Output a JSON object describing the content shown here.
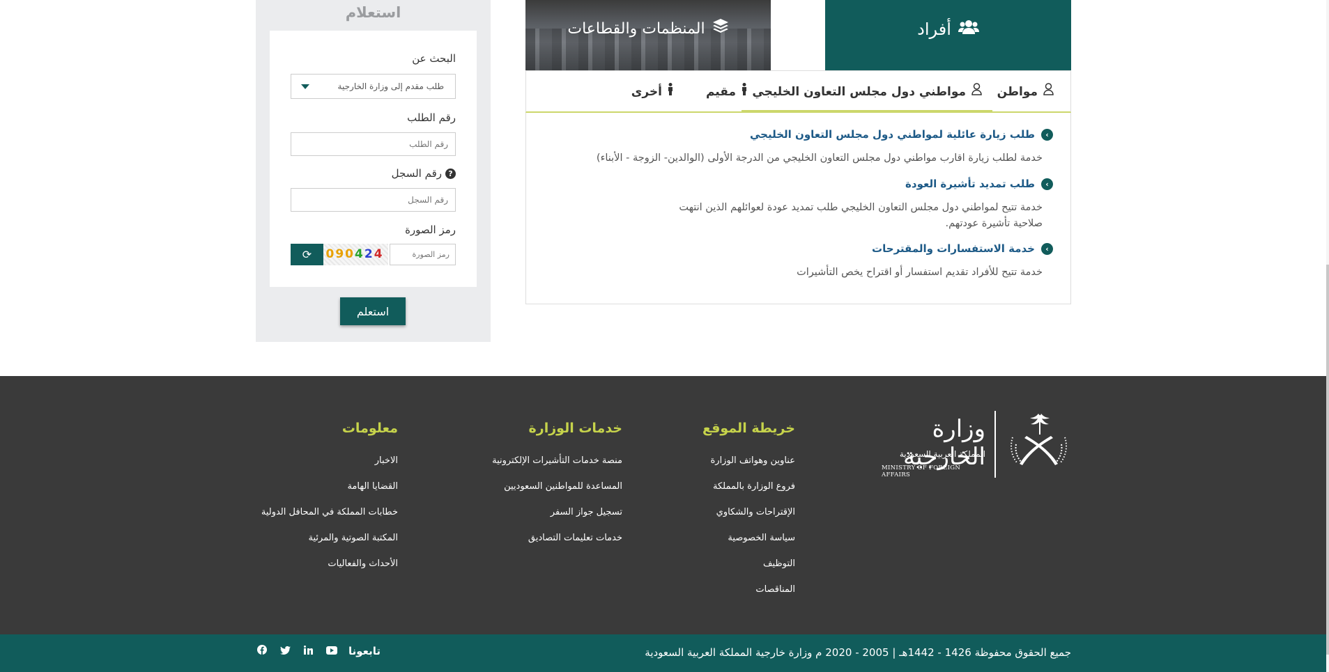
{
  "inquiry": {
    "title": "استعلام",
    "search_label": "البحث عن",
    "search_value": "طلب مقدم إلى وزارة الخارجية",
    "request_no_label": "رقم الطلب",
    "request_no_placeholder": "رقم الطلب",
    "record_no_label": "رقم السجل",
    "record_no_placeholder": "رقم السجل",
    "captcha_label": "رمز الصورة",
    "captcha_placeholder": "رمز الصورة",
    "captcha_text": [
      "0",
      "9",
      "0",
      "4",
      "2",
      "4"
    ],
    "submit_label": "استعلم"
  },
  "tabs": {
    "individuals": "أفراد",
    "organizations": "المنظمات والقطاعات"
  },
  "subtabs": {
    "citizen": "مواطن",
    "gcc": "مواطني دول مجلس التعاون الخليجي",
    "resident": "مقيم",
    "other": "أخرى"
  },
  "services": [
    {
      "title": "طلب زيارة عائلية لمواطني دول مجلس التعاون الخليجي",
      "desc": "خدمة لطلب زيارة اقارب مواطني دول مجلس التعاون الخليجي من الدرجة الأولى (الوالدين- الزوجة - الأبناء)"
    },
    {
      "title": "طلب تمديد تأشيرة العودة",
      "desc": "خدمة تتيح لمواطني دول مجلس التعاون الخليجي طلب تمديد عودة لعوائلهم الذين انتهت صلاحية تأشيرة عودتهم."
    },
    {
      "title": "خدمة الاستفسارات والمقترحات",
      "desc": "خدمة تتيح للأفراد تقديم استفسار أو اقتراح يخص التأشيرات"
    }
  ],
  "footer": {
    "logo": {
      "name_ar": "وزارة الخارجية",
      "country_ar": "المملكة العربية السعودية",
      "name_en": "MINISTRY OF FOREIGN AFFAIRS"
    },
    "sitemap": {
      "title": "خريطة الموقع",
      "links": [
        "عناوين وهواتف الوزارة",
        "فروع الوزارة بالمملكة",
        "الإقتراحات والشكاوي",
        "سياسة الخصوصية",
        "التوظيف",
        "المناقصات"
      ]
    },
    "services": {
      "title": "خدمات الوزارة",
      "links": [
        "منصة خدمات التأشيرات الإلكترونية",
        "المساعدة للمواطنين السعوديين",
        "تسجيل جواز السفر",
        "خدمات تعليمات التصاديق"
      ]
    },
    "info": {
      "title": "معلومات",
      "links": [
        "الاخبار",
        "القضايا الهامة",
        "خطابات المملكة في المحافل الدولية",
        "المكتبة الصوتية والمرئية",
        "الأحداث والفعاليات"
      ]
    }
  },
  "bottom_bar": {
    "copyright": "جميع الحقوق محفوظة 1426 - 1442هـ | 2005 - 2020 م وزارة خارجية المملكة العربية السعودية",
    "follow_label": "تابعونا",
    "social_icons": [
      "youtube-icon",
      "linkedin-icon",
      "twitter-icon",
      "facebook-icon"
    ]
  },
  "colors": {
    "primary": "#115c5b",
    "accent": "#c6d34b",
    "footer_bg": "#3a3a3a",
    "link_blue": "#1d5a87"
  }
}
